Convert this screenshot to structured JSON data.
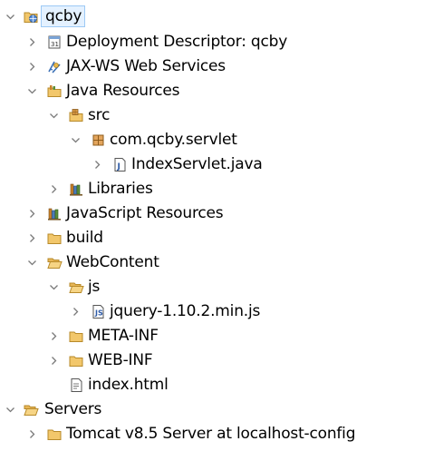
{
  "tree": {
    "rows": [
      {
        "label": "qcby",
        "icon": "web-project-icon",
        "expander": "expanded",
        "selected": true
      },
      {
        "label": "Deployment Descriptor: qcby",
        "icon": "deployment-descriptor-icon",
        "expander": "collapsed"
      },
      {
        "label": "JAX-WS Web Services",
        "icon": "web-services-icon",
        "expander": "collapsed"
      },
      {
        "label": "Java Resources",
        "icon": "java-resources-icon",
        "expander": "expanded"
      },
      {
        "label": "src",
        "icon": "source-folder-icon",
        "expander": "expanded"
      },
      {
        "label": "com.qcby.servlet",
        "icon": "package-icon",
        "expander": "expanded"
      },
      {
        "label": "IndexServlet.java",
        "icon": "java-file-icon",
        "expander": "collapsed"
      },
      {
        "label": "Libraries",
        "icon": "libraries-icon",
        "expander": "collapsed"
      },
      {
        "label": "JavaScript Resources",
        "icon": "libraries-icon",
        "expander": "collapsed"
      },
      {
        "label": "build",
        "icon": "folder-icon",
        "expander": "collapsed"
      },
      {
        "label": "WebContent",
        "icon": "folder-open-icon",
        "expander": "expanded"
      },
      {
        "label": "js",
        "icon": "folder-open-icon",
        "expander": "expanded"
      },
      {
        "label": "jquery-1.10.2.min.js",
        "icon": "javascript-file-icon",
        "expander": "collapsed"
      },
      {
        "label": "META-INF",
        "icon": "folder-icon",
        "expander": "collapsed"
      },
      {
        "label": "WEB-INF",
        "icon": "folder-icon",
        "expander": "collapsed"
      },
      {
        "label": "index.html",
        "icon": "html-file-icon",
        "expander": "none"
      },
      {
        "label": "Servers",
        "icon": "folder-open-icon",
        "expander": "expanded"
      },
      {
        "label": "Tomcat v8.5 Server at localhost-config",
        "icon": "folder-icon",
        "expander": "collapsed"
      }
    ]
  },
  "colors": {
    "selection_background": "#e4f1ff",
    "selection_border": "#9dc9f5",
    "folder_yellow": "#f2c76b",
    "folder_outline": "#b78a2a",
    "package_brown": "#b5763a",
    "arrow_gray": "#7a7a7a"
  }
}
